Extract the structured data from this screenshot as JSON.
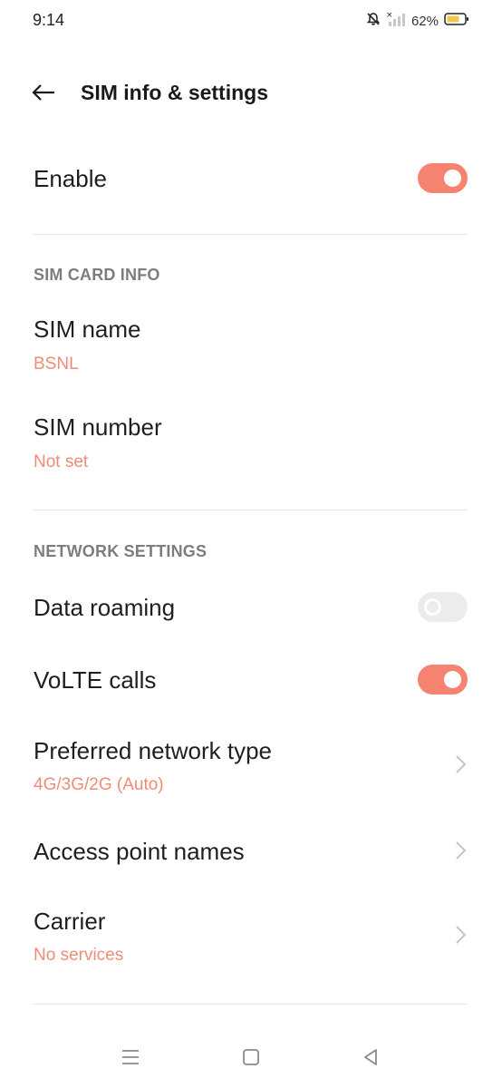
{
  "status_bar": {
    "time": "9:14",
    "battery_percent": "62%",
    "icons": [
      "bell-muted-icon",
      "no-signal-icon",
      "battery-icon"
    ]
  },
  "header": {
    "title": "SIM info & settings",
    "back_icon": "back-arrow-icon"
  },
  "enable": {
    "label": "Enable",
    "on": true
  },
  "sim_card_info": {
    "header": "SIM CARD INFO",
    "sim_name": {
      "label": "SIM name",
      "value": "BSNL"
    },
    "sim_number": {
      "label": "SIM number",
      "value": "Not set"
    }
  },
  "network_settings": {
    "header": "NETWORK SETTINGS",
    "data_roaming": {
      "label": "Data roaming",
      "on": false
    },
    "volte_calls": {
      "label": "VoLTE calls",
      "on": true
    },
    "preferred_network": {
      "label": "Preferred network type",
      "value": "4G/3G/2G (Auto)"
    },
    "access_point_names": {
      "label": "Access point names"
    },
    "carrier": {
      "label": "Carrier",
      "value": "No services"
    }
  },
  "nav_bar": {
    "icons": [
      "menu-icon",
      "home-icon",
      "back-icon"
    ]
  },
  "colors": {
    "accent": "#f5836f",
    "accent_text": "#ef8c77",
    "section_header": "#7d7d7d",
    "toggle_off": "#ececec"
  }
}
